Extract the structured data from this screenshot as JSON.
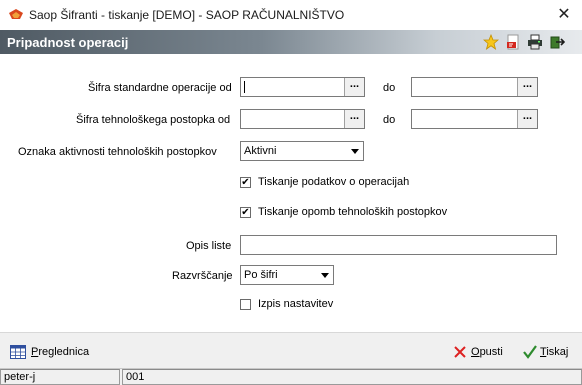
{
  "window": {
    "title": "Saop Šifranti - tiskanje [DEMO] - SAOP RAČUNALNIŠTVO",
    "close_glyph": "✕"
  },
  "header": {
    "title": "Pripadnost operacij",
    "icons": [
      "star-icon",
      "pdf-export-icon",
      "printer-icon",
      "exit-icon"
    ]
  },
  "form": {
    "std_op": {
      "label": "Šifra standardne operacije od",
      "from": "",
      "to_label": "do",
      "to": "",
      "lookup": "..."
    },
    "tech_proc": {
      "label": "Šifra tehnološkega postopka od",
      "from": "",
      "to_label": "do",
      "to": "",
      "lookup": "..."
    },
    "activity": {
      "label": "Oznaka aktivnosti tehnoloških postopkov",
      "value": "Aktivni"
    },
    "print_ops": {
      "label": "Tiskanje podatkov o  operacijah",
      "checked": true
    },
    "print_notes": {
      "label": "Tiskanje opomb tehnoloških postopkov",
      "checked": true
    },
    "list_desc": {
      "label": "Opis liste",
      "value": ""
    },
    "sort": {
      "label": "Razvrščanje",
      "value": "Po šifri"
    },
    "print_settings": {
      "label": "Izpis nastavitev",
      "checked": false
    }
  },
  "footer": {
    "preview_prefix": "P",
    "preview_rest": "reglednica",
    "cancel_prefix": "O",
    "cancel_rest": "pusti",
    "print_prefix": "T",
    "print_rest": "iskaj"
  },
  "status": {
    "user": "peter-j",
    "code": "001"
  },
  "colors": {
    "accent_check": "#2e8b2e",
    "cancel_red": "#d22",
    "header_dark": "#4f5a63"
  }
}
